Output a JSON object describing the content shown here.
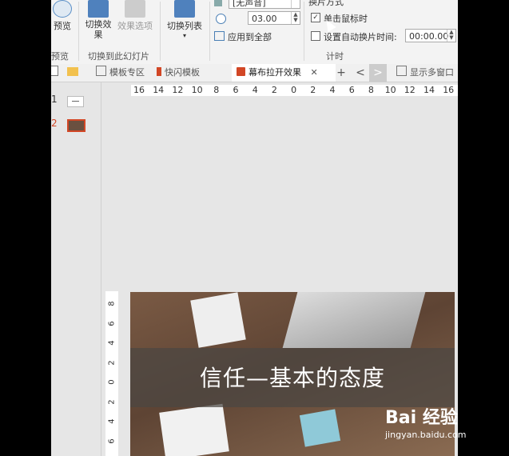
{
  "ribbon": {
    "preview_label": "预览",
    "preview_group": "预览",
    "switch_effect_label": "切换效果",
    "effect_options_label": "效果选项",
    "switch_group_label": "切换到此幻灯片",
    "switch_list_label": "切换列表",
    "sound_value": "[无声音]",
    "duration_value": "03.00",
    "apply_all_label": "应用到全部",
    "switch_mode_label": "换片方式",
    "on_click_label": "单击鼠标时",
    "auto_switch_label": "设置自动换片时间:",
    "auto_switch_value": "00:00.00",
    "timing_group": "计时"
  },
  "tabs": [
    {
      "label": "模板专区"
    },
    {
      "label": "快闪模板"
    },
    {
      "label": "幕布拉开效果",
      "active": true
    }
  ],
  "tabbar": {
    "add": "+",
    "prev": "<",
    "next": ">",
    "multi_window": "显示多窗口",
    "close": "✕"
  },
  "thumbs": [
    {
      "num": "1",
      "selected": false
    },
    {
      "num": "2",
      "selected": true
    }
  ],
  "ruler": {
    "h_ticks": [
      "16",
      "14",
      "12",
      "10",
      "8",
      "6",
      "4",
      "2",
      "0",
      "2",
      "4",
      "6",
      "8",
      "10",
      "12",
      "14",
      "16"
    ],
    "v_ticks": [
      "8",
      "6",
      "4",
      "2",
      "0",
      "2",
      "4",
      "6"
    ]
  },
  "slide": {
    "title": "信任—基本的态度"
  },
  "watermark": {
    "brand": "Bai 经验",
    "url": "jingyan.baidu.com"
  },
  "colors": {
    "accent": "#d24726",
    "ribbon_bg": "#f3f3f3",
    "canvas_bg": "#e6e6e6"
  }
}
